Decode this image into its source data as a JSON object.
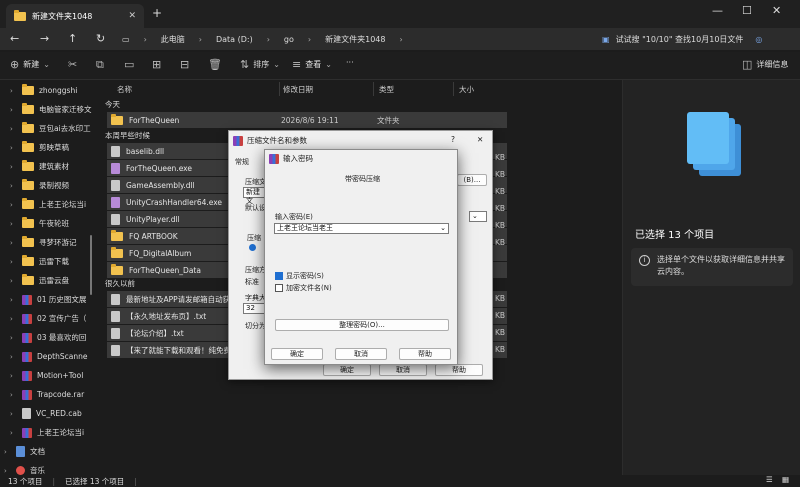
{
  "window": {
    "tab_title": "新建文件夹1048",
    "close_tab": "✕",
    "new_tab": "+"
  },
  "address": {
    "breadcrumbs": [
      "此电脑",
      "Data (D:)",
      "go",
      "新建文件夹1048"
    ],
    "search_hint": "试试搜 \"10/10\"  查找10月10日文件"
  },
  "toolbar": {
    "new_label": "新建",
    "sort_label": "排序",
    "view_label": "查看",
    "more_label": "···",
    "details_label": "详细信息"
  },
  "sidebar": {
    "items": [
      {
        "label": "zhonggshi",
        "type": "folder"
      },
      {
        "label": "电脑管家迁移文",
        "type": "folder"
      },
      {
        "label": "豆包ai去水印工",
        "type": "folder"
      },
      {
        "label": "剪映草稿",
        "type": "folder"
      },
      {
        "label": "建筑素材",
        "type": "folder"
      },
      {
        "label": "录制视频",
        "type": "folder"
      },
      {
        "label": "上老王论坛当i",
        "type": "folder"
      },
      {
        "label": "午夜轮班",
        "type": "folder"
      },
      {
        "label": "寻梦环游记",
        "type": "folder"
      },
      {
        "label": "迅雷下载",
        "type": "folder"
      },
      {
        "label": "迅雷云盘",
        "type": "folder"
      },
      {
        "label": "01 历史图文展",
        "type": "rar"
      },
      {
        "label": "02 宣传广告（",
        "type": "rar"
      },
      {
        "label": "03 最喜欢的回",
        "type": "rar"
      },
      {
        "label": "DepthScanne",
        "type": "rar"
      },
      {
        "label": "Motion+Tool",
        "type": "rar"
      },
      {
        "label": "Trapcode.rar",
        "type": "rar"
      },
      {
        "label": "VC_RED.cab",
        "type": "file"
      },
      {
        "label": "上老王论坛当i",
        "type": "rar"
      },
      {
        "label": "文档",
        "type": "doc"
      },
      {
        "label": "音乐",
        "type": "music"
      }
    ]
  },
  "filelist": {
    "columns": [
      "名称",
      "修改日期",
      "类型",
      "大小"
    ],
    "groups": [
      "今天",
      "本周早些时候",
      "很久以前"
    ],
    "today": [
      {
        "name": "ForTheQueen",
        "date": "2026/8/6 19:11",
        "type": "文件夹",
        "icon": "folder"
      }
    ],
    "this_week": [
      {
        "name": "baselib.dll",
        "icon": "file"
      },
      {
        "name": "ForTheQueen.exe",
        "icon": "exe"
      },
      {
        "name": "GameAssembly.dll",
        "icon": "file"
      },
      {
        "name": "UnityCrashHandler64.exe",
        "icon": "exe"
      },
      {
        "name": "UnityPlayer.dll",
        "icon": "file"
      },
      {
        "name": "FQ ARTBOOK",
        "icon": "folder"
      },
      {
        "name": "FQ_DigitalAlbum",
        "icon": "folder"
      },
      {
        "name": "ForTheQueen_Data",
        "icon": "folder"
      }
    ],
    "long_ago": [
      {
        "name": "最新地址及APP请发邮箱自动获取",
        "icon": "file"
      },
      {
        "name": "【永久地址发布页】.txt",
        "icon": "file"
      },
      {
        "name": "【论坛介绍】.txt",
        "icon": "file"
      },
      {
        "name": "【来了就能下载和观看！纯免费！",
        "icon": "file"
      }
    ],
    "size_units": [
      "KB",
      "KB",
      "KB",
      "KB",
      "KB",
      "KB",
      "KB",
      "KB",
      "KB",
      "KB"
    ]
  },
  "details": {
    "selected": "已选择 13 个项目",
    "info": "选择单个文件以获取详细信息并共享云内容。"
  },
  "status": {
    "count": "13 个项目",
    "selected": "已选择 13 个项目"
  },
  "dialog_back": {
    "title": "压缩文件名和参数",
    "tab_general": "常规",
    "lbl_archive": "压缩文",
    "archive_value": "新建文",
    "lbl_default": "默认设",
    "lbl_format": "压缩",
    "lbl_method": "压缩方",
    "method_value": "标准",
    "lbl_dict": "字典大",
    "dict_value": "32",
    "lbl_split": "切分为",
    "browse": "(B)...",
    "help_mark": "?",
    "close": "✕",
    "ok": "确定",
    "cancel": "取消",
    "help": "帮助"
  },
  "dialog_front": {
    "title": "输入密码",
    "subtitle": "带密码压缩",
    "lbl_password": "输入密码(E)",
    "password_value": "上老王论坛当老王",
    "show_password": "显示密码(S)",
    "encrypt_names": "加密文件名(N)",
    "organize": "整理密码(O)...",
    "ok": "确定",
    "cancel": "取消",
    "help": "帮助"
  }
}
